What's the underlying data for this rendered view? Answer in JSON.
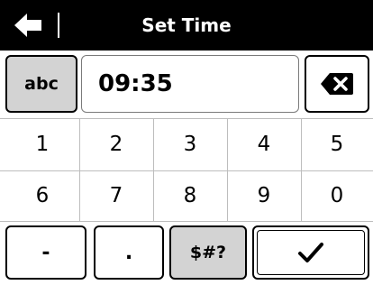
{
  "header": {
    "title": "Set Time",
    "back_icon": "arrow-left-icon"
  },
  "input": {
    "mode_label": "abc",
    "value": "09:35",
    "backspace_icon": "backspace-icon"
  },
  "keypad": {
    "row1": [
      "1",
      "2",
      "3",
      "4",
      "5"
    ],
    "row2": [
      "6",
      "7",
      "8",
      "9",
      "0"
    ],
    "bottom": {
      "dash": "-",
      "dot": ".",
      "symbols": "$#?",
      "confirm_icon": "checkmark-icon"
    }
  }
}
